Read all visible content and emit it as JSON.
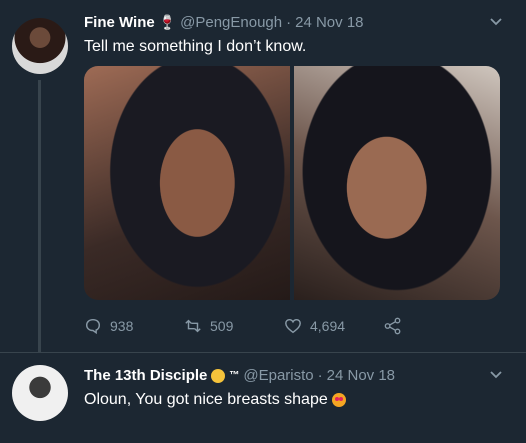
{
  "tweet1": {
    "name": "Fine Wine",
    "handle": "@PengEnough",
    "dot": "·",
    "date": "24 Nov 18",
    "text": "Tell me something I don’t know.",
    "actions": {
      "replies": "938",
      "retweets": "509",
      "likes": "4,694"
    },
    "icons": [
      "wine-glass-icon",
      "chevron-down-icon",
      "reply-icon",
      "retweet-icon",
      "like-icon",
      "share-icon"
    ]
  },
  "tweet2": {
    "name": "The 13th Disciple",
    "tm": "™",
    "handle": "@Eparisto",
    "dot": "·",
    "date": "24 Nov 18",
    "text": "Oloun, You got nice breasts shape",
    "icons": [
      "smirk-emoji-icon",
      "heart-eyes-emoji-icon",
      "chevron-down-icon"
    ]
  },
  "colors": {
    "background": "#1c2732",
    "muted": "#8899a6",
    "divider": "#38444d"
  }
}
